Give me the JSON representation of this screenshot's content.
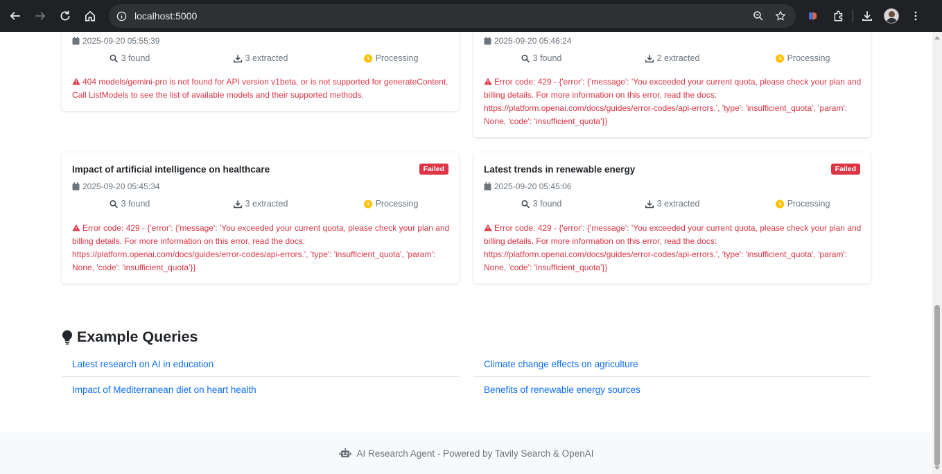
{
  "browser": {
    "url": "localhost:5000"
  },
  "cards": [
    {
      "title": "",
      "status": "",
      "date": "2025-09-20 05:55:39",
      "found": "3 found",
      "extracted": "3 extracted",
      "state": "Processing",
      "error": "404 models/gemini-pro is not found for API version v1beta, or is not supported for generateContent. Call ListModels to see the list of available models and their supported methods."
    },
    {
      "title": "",
      "status": "",
      "date": "2025-09-20 05:46:24",
      "found": "3 found",
      "extracted": "2 extracted",
      "state": "Processing",
      "error": "Error code: 429 - {'error': {'message': 'You exceeded your current quota, please check your plan and billing details. For more information on this error, read the docs: https://platform.openai.com/docs/guides/error-codes/api-errors.', 'type': 'insufficient_quota', 'param': None, 'code': 'insufficient_quota'}}"
    },
    {
      "title": "Impact of artificial intelligence on healthcare",
      "status": "Failed",
      "date": "2025-09-20 05:45:34",
      "found": "3 found",
      "extracted": "3 extracted",
      "state": "Processing",
      "error": "Error code: 429 - {'error': {'message': 'You exceeded your current quota, please check your plan and billing details. For more information on this error, read the docs: https://platform.openai.com/docs/guides/error-codes/api-errors.', 'type': 'insufficient_quota', 'param': None, 'code': 'insufficient_quota'}}"
    },
    {
      "title": "Latest trends in renewable energy",
      "status": "Failed",
      "date": "2025-09-20 05:45:06",
      "found": "3 found",
      "extracted": "3 extracted",
      "state": "Processing",
      "error": "Error code: 429 - {'error': {'message': 'You exceeded your current quota, please check your plan and billing details. For more information on this error, read the docs: https://platform.openai.com/docs/guides/error-codes/api-errors.', 'type': 'insufficient_quota', 'param': None, 'code': 'insufficient_quota'}}"
    }
  ],
  "examples": {
    "title": "Example Queries",
    "queries": [
      "Latest research on AI in education",
      "Climate change effects on agriculture",
      "Impact of Mediterranean diet on heart health",
      "Benefits of renewable energy sources"
    ]
  },
  "footer": {
    "text": "AI Research Agent - Powered by Tavily Search & OpenAI"
  },
  "colors": {
    "danger": "#dc3545",
    "link": "#0d6efd",
    "warning": "#ffc107",
    "muted": "#6c757d"
  }
}
